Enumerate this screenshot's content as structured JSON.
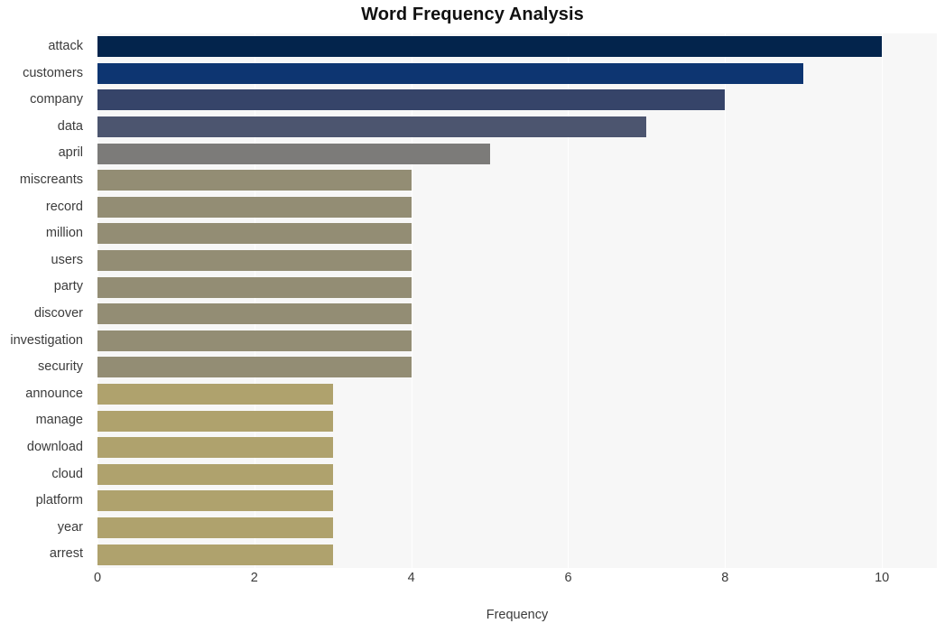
{
  "chart_data": {
    "type": "bar",
    "orientation": "horizontal",
    "title": "Word Frequency Analysis",
    "xlabel": "Frequency",
    "ylabel": "",
    "xlim": [
      0,
      10.7
    ],
    "xticks": [
      "0",
      "2",
      "4",
      "6",
      "8",
      "10"
    ],
    "xtick_values": [
      0,
      2,
      4,
      6,
      8,
      10
    ],
    "grid": "vertical",
    "legend": "none",
    "categories": [
      "attack",
      "customers",
      "company",
      "data",
      "april",
      "miscreants",
      "record",
      "million",
      "users",
      "party",
      "discover",
      "investigation",
      "security",
      "announce",
      "manage",
      "download",
      "cloud",
      "platform",
      "year",
      "arrest"
    ],
    "values": [
      10,
      9,
      8,
      7,
      5,
      4,
      4,
      4,
      4,
      4,
      4,
      4,
      4,
      3,
      3,
      3,
      3,
      3,
      3,
      3
    ],
    "bar_colors": [
      "#03244c",
      "#0d3571",
      "#364469",
      "#4c556f",
      "#7c7b79",
      "#938d74",
      "#938d74",
      "#938d74",
      "#938d74",
      "#938d74",
      "#938d74",
      "#938d74",
      "#938d74",
      "#afa26d",
      "#afa26d",
      "#afa26d",
      "#afa26d",
      "#afa26d",
      "#afa26d",
      "#afa26d"
    ],
    "plot_background": "#f7f7f7",
    "grid_color": "#ffffff",
    "figure_background": "#ffffff"
  }
}
